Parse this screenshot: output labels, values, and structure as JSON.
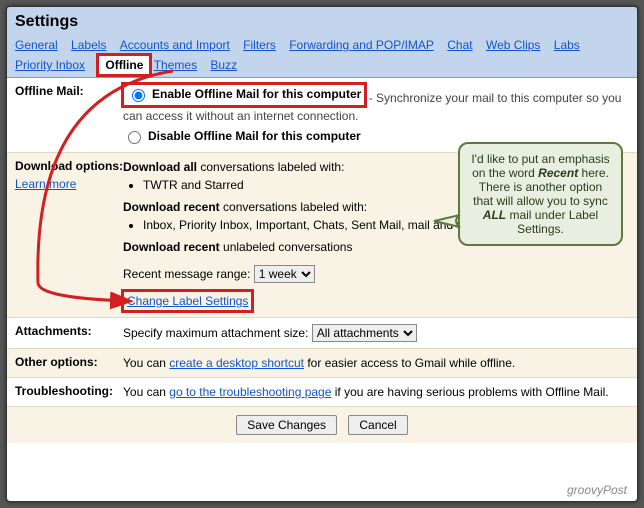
{
  "title": "Settings",
  "tabs": [
    "General",
    "Labels",
    "Accounts and Import",
    "Filters",
    "Forwarding and POP/IMAP",
    "Chat",
    "Web Clips",
    "Labs",
    "Priority Inbox",
    "Offline",
    "Themes",
    "Buzz"
  ],
  "activeTab": "Offline",
  "offline": {
    "label": "Offline Mail:",
    "enable": "Enable Offline Mail for this computer",
    "enableDesc": " - Synchronize your mail to this computer so you can access it without an internet connection.",
    "disable": "Disable Offline Mail for this computer"
  },
  "download": {
    "label": "Download options:",
    "learn": "Learn more",
    "all": "Download all",
    "allDesc": " conversations labeled with:",
    "allItems": "TWTR and Starred",
    "recent": "Download recent",
    "recentDesc": " conversations labeled with:",
    "recentItems": "Inbox, Priority Inbox, Important, Chats, Sent Mail, mail and SU.PR",
    "recentUnlabeled": "Download recent",
    "recentUnlabeledDesc": " unlabeled conversations",
    "rangeLabel": "Recent message range:",
    "rangeValue": "1 week",
    "changeLabels": "Change Label Settings"
  },
  "attachments": {
    "label": "Attachments:",
    "text": "Specify maximum attachment size:",
    "value": "All attachments"
  },
  "other": {
    "label": "Other options:",
    "before": "You can ",
    "link": "create a desktop shortcut",
    "after": " for easier access to Gmail while offline."
  },
  "trouble": {
    "label": "Troubleshooting:",
    "before": "You can ",
    "link": "go to the troubleshooting page",
    "after": " if you are having serious problems with Offline Mail."
  },
  "buttons": {
    "save": "Save Changes",
    "cancel": "Cancel"
  },
  "callout": {
    "l1": "I'd like to put an emphasis on the word ",
    "em": "Recent",
    "l2": " here. There is another option that will allow you to sync ",
    "em2": "ALL",
    "l3": " mail under Label Settings."
  },
  "watermark": "groovyPost"
}
